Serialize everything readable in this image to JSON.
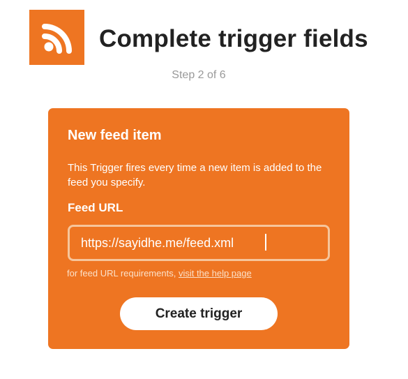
{
  "header": {
    "logo_icon": "rss-feed-icon",
    "title": "Complete trigger fields",
    "step": "Step 2 of 6"
  },
  "card": {
    "title": "New feed item",
    "description": "This Trigger fires every time a new item is added to the feed you specify.",
    "field_label": "Feed URL",
    "feed_url_value": "https://sayidhe.me/feed.xml",
    "helper_prefix": "for feed URL requirements, ",
    "helper_link": "visit the help page",
    "button_label": "Create trigger"
  },
  "colors": {
    "accent": "#ee7522",
    "title_text": "#222222",
    "muted_text": "#999999",
    "button_bg": "#ffffff"
  }
}
